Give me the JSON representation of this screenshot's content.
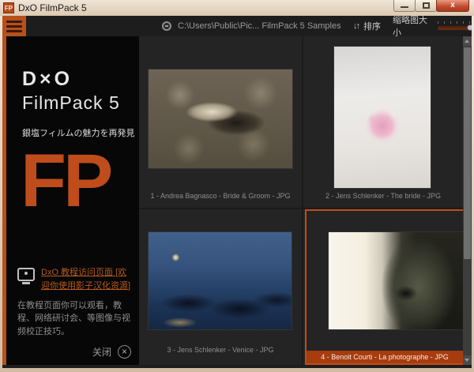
{
  "window": {
    "title": "DxO FilmPack 5",
    "app_icon_text": "FP"
  },
  "toolbar": {
    "path": "C:\\Users\\Public\\Pic... FilmPack 5 Samples",
    "sort_label": "排序",
    "thumbnail_size_label": "缩略图大小",
    "thumbnail_slider_percent": 100
  },
  "icons": {
    "sort_glyph": "↓↑",
    "close_circle_glyph": "×"
  },
  "sidebar": {
    "brand_logo": "D×O",
    "brand_name": "FilmPack 5",
    "tagline": "銀塩フィルムの魅力を再発見",
    "monogram": "FP",
    "tutorial_link": "DxO 教程访问页面 [欢迎你使用影子汉化资源]",
    "tutorial_description": "在教程页面你可以观看，教程、网络研讨会、等图像与视频校正技巧。",
    "close_label": "关闭"
  },
  "gallery": {
    "items": [
      {
        "caption": "1 - Andrea Bagnasco - Bride & Groom - JPG",
        "selected": false
      },
      {
        "caption": "2 - Jens Schlenker - The bride - JPG",
        "selected": false
      },
      {
        "caption": "3 - Jens Schlenker - Venice - JPG",
        "selected": false
      },
      {
        "caption": "4 - Benoit Courti - La photographe - JPG",
        "selected": true
      }
    ]
  },
  "colors": {
    "accent_orange": "#b5511d",
    "monogram_orange": "#bf4c1b",
    "selected_border": "#c24d15",
    "selected_caption_bg": "#a63c10",
    "close_button_red": "#c04a2c"
  }
}
